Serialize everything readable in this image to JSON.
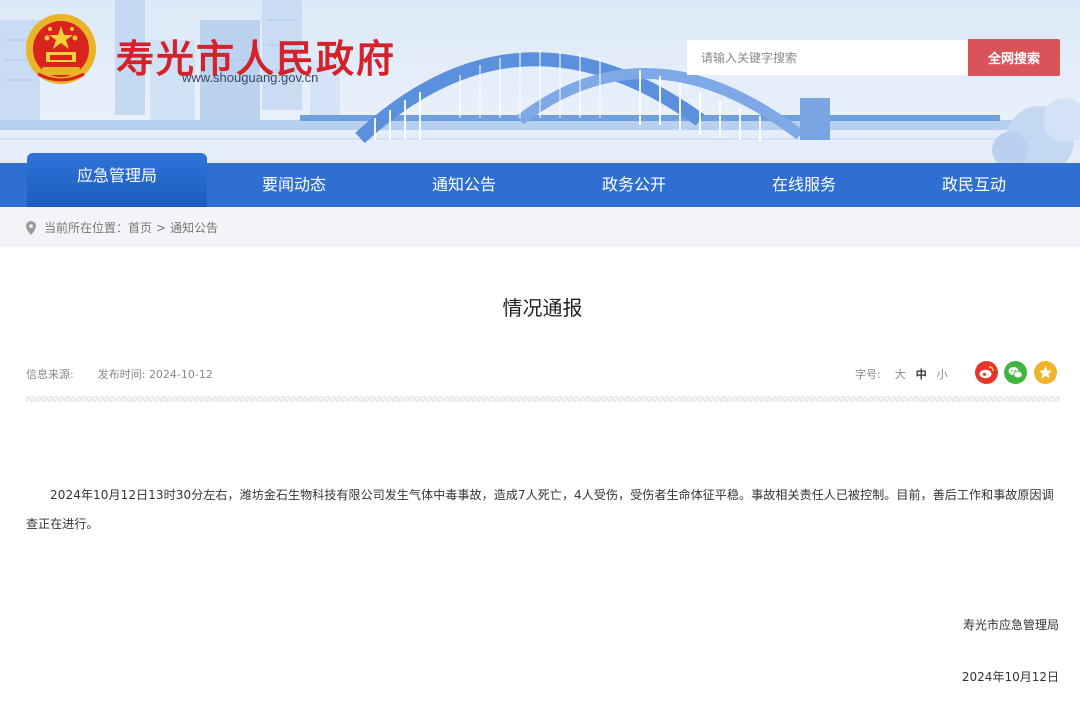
{
  "header": {
    "site_title": "寿光市人民政府",
    "site_url": "www.shouguang.gov.cn",
    "search_placeholder": "请输入关键字搜索",
    "search_button": "全网搜索"
  },
  "nav": {
    "items": [
      {
        "label": "应急管理局",
        "active": true
      },
      {
        "label": "要闻动态",
        "active": false
      },
      {
        "label": "通知公告",
        "active": false
      },
      {
        "label": "政务公开",
        "active": false
      },
      {
        "label": "在线服务",
        "active": false
      },
      {
        "label": "政民互动",
        "active": false
      }
    ]
  },
  "breadcrumb": {
    "prefix": "当前所在位置：",
    "home": "首页",
    "separator": ">",
    "current": "通知公告"
  },
  "article": {
    "title": "情况通报",
    "source_label": "信息来源:",
    "source_value": "",
    "date_label": "发布时间:",
    "date_value": "2024-10-12",
    "fontsize_label": "字号:",
    "fontsize_options": [
      "大",
      "中",
      "小"
    ],
    "fontsize_selected": "中",
    "body": "2024年10月12日13时30分左右，潍坊金石生物科技有限公司发生气体中毒事故，造成7人死亡，4人受伤，受伤者生命体征平稳。事故相关责任人已被控制。目前，善后工作和事故原因调查正在进行。",
    "signature_org": "寿光市应急管理局",
    "signature_date": "2024年10月12日"
  },
  "share_icons": [
    "weibo-icon",
    "wechat-icon",
    "favorite-icon"
  ],
  "colors": {
    "brand_red": "#d4212a",
    "nav_blue": "#2e6fd1",
    "search_button": "#d9535a"
  }
}
